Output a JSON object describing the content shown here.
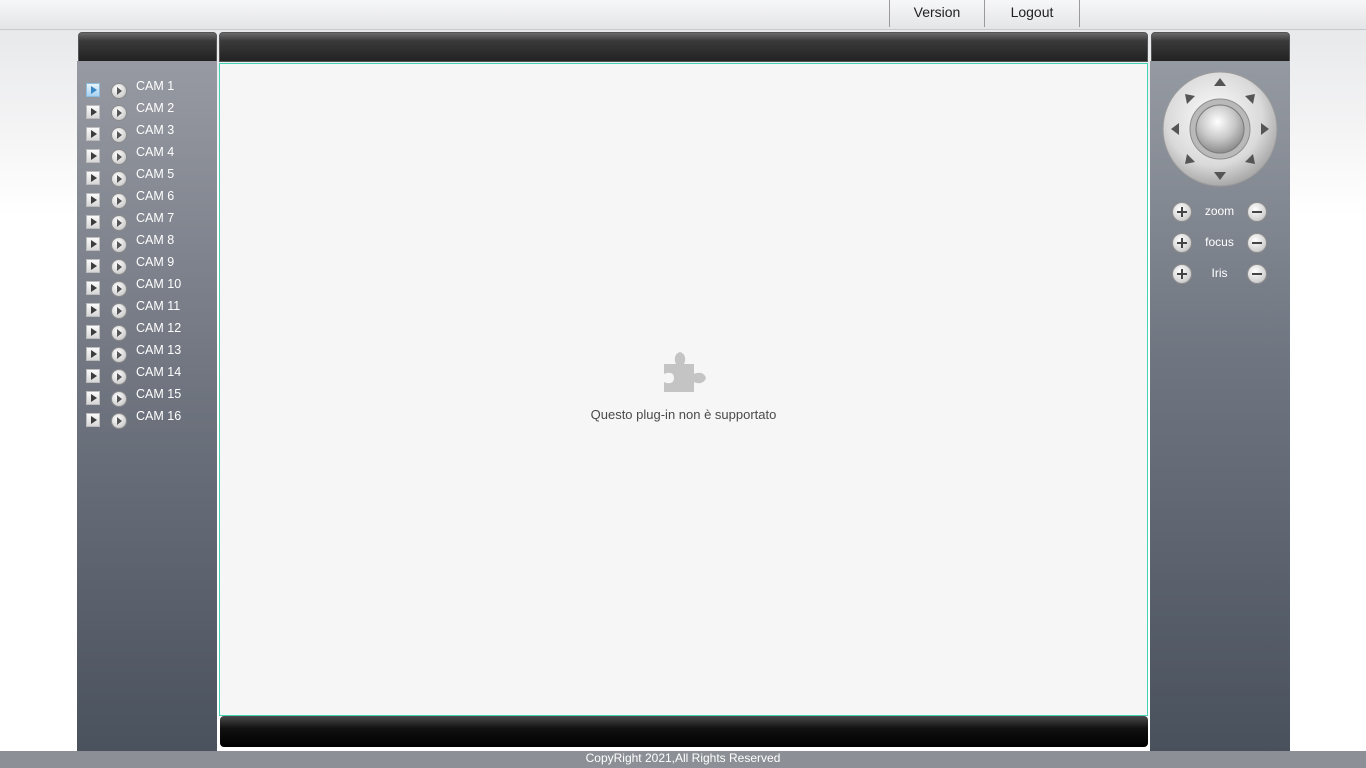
{
  "topnav": {
    "version_label": "Version",
    "logout_label": "Logout"
  },
  "cameras": [
    {
      "label": "CAM 1",
      "active": true
    },
    {
      "label": "CAM 2"
    },
    {
      "label": "CAM 3"
    },
    {
      "label": "CAM 4"
    },
    {
      "label": "CAM 5"
    },
    {
      "label": "CAM 6"
    },
    {
      "label": "CAM 7"
    },
    {
      "label": "CAM 8"
    },
    {
      "label": "CAM 9"
    },
    {
      "label": "CAM 10"
    },
    {
      "label": "CAM 11"
    },
    {
      "label": "CAM 12"
    },
    {
      "label": "CAM 13"
    },
    {
      "label": "CAM 14"
    },
    {
      "label": "CAM 15"
    },
    {
      "label": "CAM 16"
    }
  ],
  "video": {
    "plugin_message": "Questo plug-in non è supportato"
  },
  "ptz": {
    "zoom_label": "zoom",
    "focus_label": "focus",
    "iris_label": "Iris"
  },
  "footer": {
    "copyright": "CopyRight 2021,All Rights Reserved"
  },
  "colors": {
    "video_border": "#44d3b5",
    "active_cam": "#3a87c6"
  },
  "icons": {
    "plugin": "puzzle-piece-icon",
    "play": "play-icon",
    "record": "record-icon"
  }
}
